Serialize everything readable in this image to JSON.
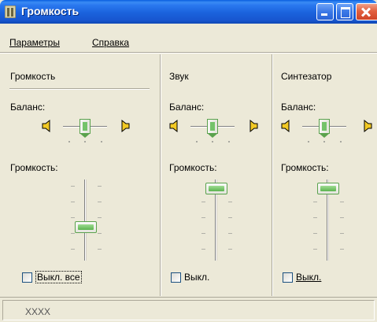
{
  "window": {
    "title": "Громкость"
  },
  "menu": {
    "params": "Параметры",
    "help": "Справка"
  },
  "columns": [
    {
      "title": "Громкость",
      "balance_label": "Баланс:",
      "balance": 0.5,
      "volume_label": "Громкость:",
      "volume": 0.4,
      "mute_label": "Выкл. все",
      "muted": false
    },
    {
      "title": "Звук",
      "balance_label": "Баланс:",
      "balance": 0.5,
      "volume_label": "Громкость:",
      "volume": 0.95,
      "mute_label": "Выкл.",
      "muted": false
    },
    {
      "title": "Синтезатор",
      "balance_label": "Баланс:",
      "balance": 0.5,
      "volume_label": "Громкость:",
      "volume": 0.95,
      "mute_label": "Выкл.",
      "muted": false
    }
  ],
  "status": {
    "text": "XXXX"
  },
  "icons": {
    "title": "speaker-volume-icon",
    "left_speaker": "speaker-left-icon",
    "right_speaker": "speaker-right-icon"
  },
  "colors": {
    "titlebar": "#1a62dc",
    "slider_thumb": "#5cb44f",
    "face": "#ece9d8"
  }
}
